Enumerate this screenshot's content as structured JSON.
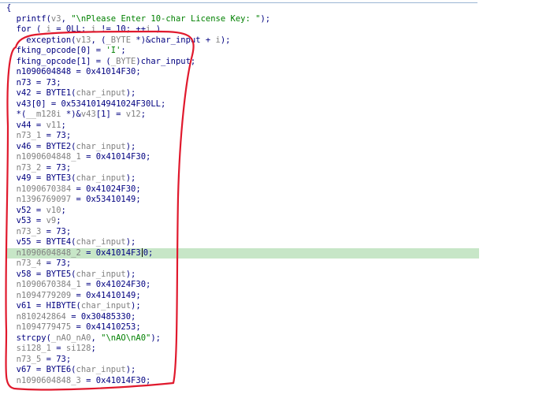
{
  "editor": {
    "lines": [
      [
        "{"
      ],
      [
        "  ",
        {
          "t": "fn",
          "v": "printf"
        },
        "(",
        {
          "t": "var",
          "v": "v3"
        },
        ", ",
        {
          "t": "str",
          "v": "\"\\nPlease Enter 10-char License Key: \""
        },
        ");"
      ],
      [
        "  ",
        {
          "t": "kw",
          "v": "for"
        },
        " ( ",
        {
          "t": "var",
          "v": "i"
        },
        " = 0LL; ",
        {
          "t": "var",
          "v": "i"
        },
        " != 10; ++",
        {
          "t": "var",
          "v": "i"
        },
        " )"
      ],
      [
        "    exception(",
        {
          "t": "var",
          "v": "v13"
        },
        ", (",
        {
          "t": "var",
          "v": "_BYTE"
        },
        " *)&char_input + ",
        {
          "t": "var",
          "v": "i"
        },
        ");"
      ],
      [
        "  fking_opcode[0] = ",
        {
          "t": "str",
          "v": "'I'"
        },
        ";"
      ],
      [
        "  fking_opcode[1] = (",
        {
          "t": "var",
          "v": "_BYTE"
        },
        ")char_input;"
      ],
      [
        "  n1090604848 = 0x41014F30;"
      ],
      [
        "  n73 = 73;"
      ],
      [
        "  v42 = BYTE1(",
        {
          "t": "var",
          "v": "char_input"
        },
        ");"
      ],
      [
        "  v43[0] = 0x5341014941024F30LL;"
      ],
      [
        "  *(",
        {
          "t": "var",
          "v": "__m128i"
        },
        " *)&",
        {
          "t": "var",
          "v": "v43"
        },
        "[1] = ",
        {
          "t": "var",
          "v": "v12"
        },
        ";"
      ],
      [
        "  v44 = ",
        {
          "t": "var",
          "v": "v11"
        },
        ";"
      ],
      [
        "  ",
        {
          "t": "var",
          "v": "n73_1"
        },
        " = 73;"
      ],
      [
        "  v46 = BYTE2(",
        {
          "t": "var",
          "v": "char_input"
        },
        ");"
      ],
      [
        "  ",
        {
          "t": "var",
          "v": "n1090604848_1"
        },
        " = 0x41014F30;"
      ],
      [
        "  ",
        {
          "t": "var",
          "v": "n73_2"
        },
        " = 73;"
      ],
      [
        "  v49 = BYTE3(",
        {
          "t": "var",
          "v": "char_input"
        },
        ");"
      ],
      [
        "  ",
        {
          "t": "var",
          "v": "n1090670384"
        },
        " = 0x41024F30;"
      ],
      [
        "  ",
        {
          "t": "var",
          "v": "n1396769097"
        },
        " = 0x53410149;"
      ],
      [
        "  v52 = ",
        {
          "t": "var",
          "v": "v10"
        },
        ";"
      ],
      [
        "  v53 = ",
        {
          "t": "var",
          "v": "v9"
        },
        ";"
      ],
      [
        "  ",
        {
          "t": "var",
          "v": "n73_3"
        },
        " = 73;"
      ],
      [
        "  v55 = BYTE4(",
        {
          "t": "var",
          "v": "char_input"
        },
        ");"
      ],
      [
        "  ",
        {
          "t": "var",
          "v": "n1090604848_2"
        },
        " = 0x41014F3",
        {
          "t": "cursor"
        },
        "0;"
      ],
      [
        "  ",
        {
          "t": "var",
          "v": "n73_4"
        },
        " = 73;"
      ],
      [
        "  v58 = BYTE5(",
        {
          "t": "var",
          "v": "char_input"
        },
        ");"
      ],
      [
        "  ",
        {
          "t": "var",
          "v": "n1090670384_1"
        },
        " = 0x41024F30;"
      ],
      [
        "  ",
        {
          "t": "var",
          "v": "n1094779209"
        },
        " = 0x41410149;"
      ],
      [
        "  v61 = HIBYTE(",
        {
          "t": "var",
          "v": "char_input"
        },
        ");"
      ],
      [
        "  ",
        {
          "t": "var",
          "v": "n810242864"
        },
        " = 0x30485330;"
      ],
      [
        "  ",
        {
          "t": "var",
          "v": "n1094779475"
        },
        " = 0x41410253;"
      ],
      [
        "  strcpy(",
        {
          "t": "var",
          "v": "_nAO_nA0"
        },
        ", ",
        {
          "t": "str",
          "v": "\"\\nAO\\nA0\""
        },
        ");"
      ],
      [
        "  ",
        {
          "t": "var",
          "v": "si128_1"
        },
        " = ",
        {
          "t": "var",
          "v": "si128"
        },
        ";"
      ],
      [
        "  ",
        {
          "t": "var",
          "v": "n73_5"
        },
        " = 73;"
      ],
      [
        "  v67 = BYTE6(",
        {
          "t": "var",
          "v": "char_input"
        },
        ");"
      ],
      [
        "  ",
        {
          "t": "var",
          "v": "n1090604848_3"
        },
        " = 0x41014F30;"
      ]
    ],
    "highlighted_line": 23
  },
  "colors": {
    "annotation": "#e0192d",
    "highlight": "#c7e6c7",
    "code": "#000080",
    "string": "#008000",
    "identifier": "#808080"
  }
}
